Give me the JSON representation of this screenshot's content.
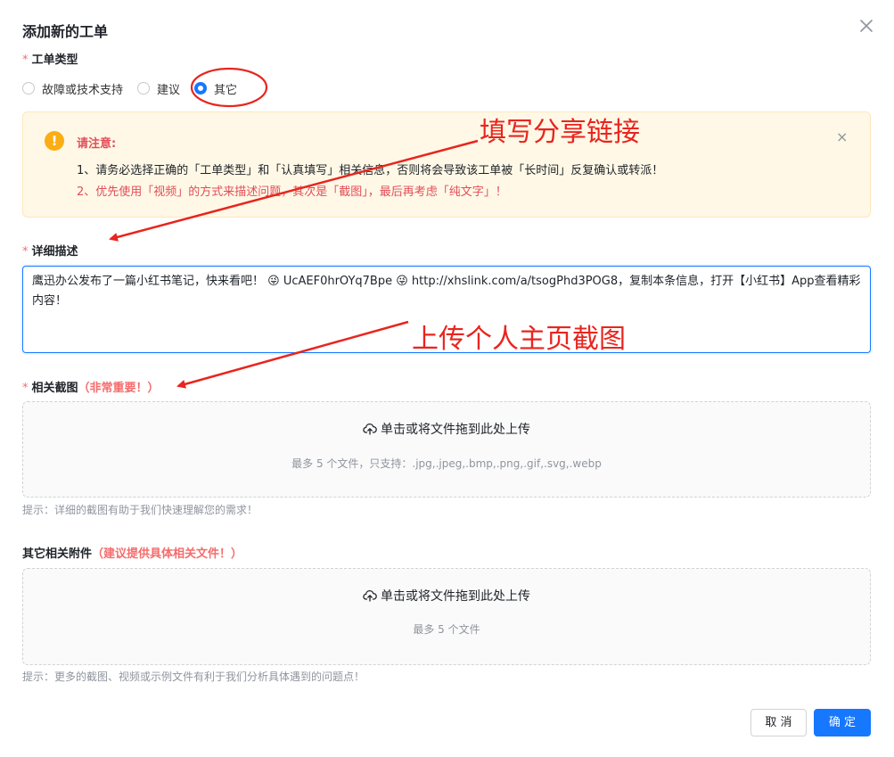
{
  "dialog": {
    "title": "添加新的工单",
    "close_icon": "close-icon"
  },
  "ticket_type": {
    "required_mark": "*",
    "label": "工单类型",
    "options": [
      {
        "label": "故障或技术支持",
        "checked": false
      },
      {
        "label": "建议",
        "checked": false
      },
      {
        "label": "其它",
        "checked": true
      }
    ]
  },
  "notice": {
    "icon": "warning-icon",
    "icon_glyph": "!",
    "title": "请注意:",
    "line1": "1、请务必选择正确的「工单类型」和「认真填写」相关信息，否则将会导致该工单被「长时间」反复确认或转派！",
    "line2": "2、优先使用「视频」的方式来描述问题，其次是「截图」，最后再考虑「纯文字」！",
    "close_glyph": "×"
  },
  "description": {
    "required_mark": "*",
    "label": "详细描述",
    "value": "鹰迅办公发布了一篇小红书笔记，快来看吧！ 😜 UcAEF0hrOYq7Bpe 😜 http://xhslink.com/a/tsogPhd3POG8，复制本条信息，打开【小红书】App查看精彩内容！"
  },
  "screenshots": {
    "required_mark": "*",
    "label": "相关截图",
    "label_note": "（非常重要！）",
    "upload_text": "单击或将文件拖到此处上传",
    "upload_sub": "最多 5 个文件，只支持：.jpg,.jpeg,.bmp,.png,.gif,.svg,.webp",
    "hint": "提示：详细的截图有助于我们快速理解您的需求！"
  },
  "attachments": {
    "label": "其它相关附件",
    "label_note": "（建议提供具体相关文件！）",
    "upload_text": "单击或将文件拖到此处上传",
    "upload_sub": "最多 5 个文件",
    "hint": "提示：更多的截图、视频或示例文件有利于我们分析具体遇到的问题点！"
  },
  "footer": {
    "cancel_label": "取 消",
    "ok_label": "确 定"
  },
  "annotations": {
    "link_text": "填写分享链接",
    "screenshot_text": "上传个人主页截图",
    "color": "#e8251e"
  },
  "colors": {
    "primary": "#1677ff",
    "danger": "#f56c6c",
    "warning": "#faad14"
  }
}
